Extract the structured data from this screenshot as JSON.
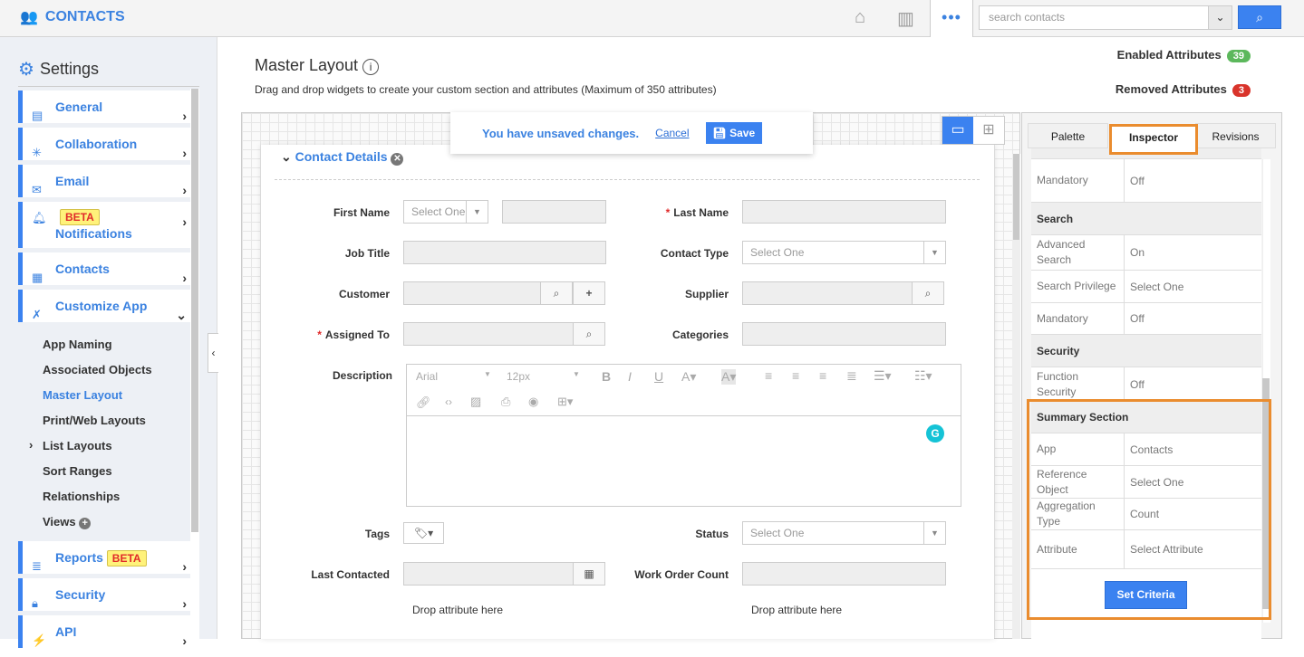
{
  "app": {
    "title": "CONTACTS",
    "more_label": "•••",
    "search_placeholder": "search contacts"
  },
  "sidebar": {
    "title": "Settings",
    "items": [
      {
        "label": "General",
        "icon": "monitor-icon"
      },
      {
        "label": "Collaboration",
        "icon": "network-icon"
      },
      {
        "label": "Email",
        "icon": "envelope-icon"
      },
      {
        "label": "Notifications",
        "icon": "bell-icon",
        "badge": "BETA"
      },
      {
        "label": "Contacts",
        "icon": "contacts-card-icon"
      },
      {
        "label": "Customize App",
        "icon": "tools-icon"
      },
      {
        "label": "Reports",
        "icon": "report-icon",
        "badge": "BETA"
      },
      {
        "label": "Security",
        "icon": "lock-icon"
      },
      {
        "label": "API",
        "icon": "plug-icon"
      }
    ],
    "subitems": [
      "App Naming",
      "Associated Objects",
      "Master Layout",
      "Print/Web Layouts",
      "List Layouts",
      "Sort Ranges",
      "Relationships",
      "Views"
    ],
    "active_subitem": "Master Layout"
  },
  "main": {
    "title": "Master Layout",
    "subtitle": "Drag and drop widgets to create your custom section and attributes (Maximum of 350 attributes)",
    "enabled_label": "Enabled Attributes",
    "enabled_count": "39",
    "removed_label": "Removed Attributes",
    "removed_count": "3",
    "banner": {
      "message": "You have unsaved changes.",
      "cancel": "Cancel",
      "save": "Save"
    },
    "section_title": "Contact Details",
    "fields": {
      "first_name": "First Name",
      "first_name_select": "Select One",
      "last_name": "Last Name",
      "job_title": "Job Title",
      "contact_type": "Contact Type",
      "contact_type_value": "Select One",
      "customer": "Customer",
      "supplier": "Supplier",
      "assigned_to": "Assigned To",
      "categories": "Categories",
      "description": "Description",
      "tags": "Tags",
      "status": "Status",
      "status_value": "Select One",
      "last_contacted": "Last Contacted",
      "work_order_count": "Work Order Count",
      "drop_left": "Drop attribute here",
      "drop_right": "Drop attribute here"
    },
    "editor": {
      "font": "Arial",
      "size": "12px"
    }
  },
  "panel": {
    "tabs": [
      "Palette",
      "Inspector",
      "Revisions"
    ],
    "active_tab": "Inspector",
    "rows": [
      {
        "k": "Mandatory",
        "v": "Off"
      },
      {
        "header": "Search"
      },
      {
        "k": "Advanced Search",
        "v": "On"
      },
      {
        "k": "Search Privilege",
        "v": "Select One"
      },
      {
        "k": "Mandatory",
        "v": "Off"
      },
      {
        "header": "Security"
      },
      {
        "k": "Function Security",
        "v": "Off"
      },
      {
        "header": "Summary Section"
      },
      {
        "k": "App",
        "v": "Contacts"
      },
      {
        "k": "Reference Object",
        "v": "Select One"
      },
      {
        "k": "Aggregation Type",
        "v": "Count"
      },
      {
        "k": "Attribute",
        "v": "Select Attribute"
      }
    ],
    "set_criteria": "Set Criteria"
  },
  "colors": {
    "accent": "#3b82f0",
    "highlight": "#ea8c2e",
    "enabled": "#5cb85c",
    "removed": "#d9342b",
    "beta_bg": "#fff27a"
  }
}
